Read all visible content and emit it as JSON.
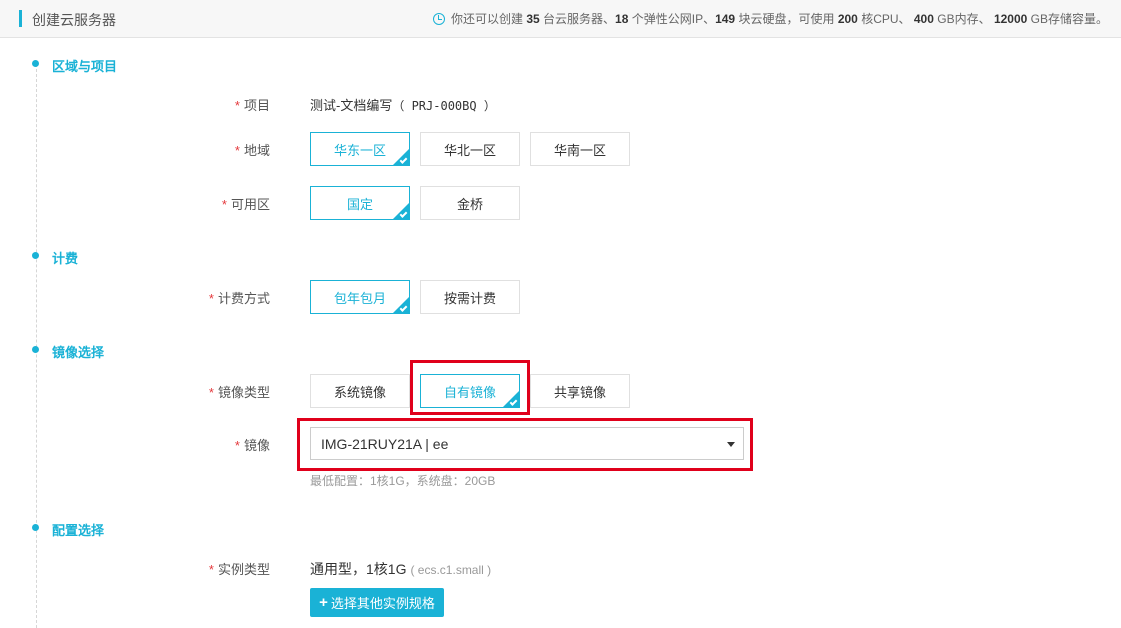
{
  "header": {
    "title": "创建云服务器",
    "quota": {
      "prefix": "你还可以创建",
      "servers": "35",
      "servers_unit": "台云服务器、",
      "ips": "18",
      "ips_unit": "个弹性公网IP、",
      "disks": "149",
      "disks_unit": "块云硬盘，可使用",
      "cpu": "200",
      "cpu_unit": "核CPU、",
      "mem": "400",
      "mem_unit": "GB内存、",
      "storage": "12000",
      "storage_unit": "GB存储容量。"
    }
  },
  "sections": {
    "region": {
      "title": "区域与项目",
      "project_label": "项目",
      "project_name": "测试-文档编写",
      "project_code": "（ PRJ-000BQ ）",
      "region_label": "地域",
      "regions": [
        "华东一区",
        "华北一区",
        "华南一区"
      ],
      "zone_label": "可用区",
      "zones": [
        "国定",
        "金桥"
      ]
    },
    "billing": {
      "title": "计费",
      "method_label": "计费方式",
      "methods": [
        "包年包月",
        "按需计费"
      ]
    },
    "image": {
      "title": "镜像选择",
      "type_label": "镜像类型",
      "types": [
        "系统镜像",
        "自有镜像",
        "共享镜像"
      ],
      "image_label": "镜像",
      "selected_image": "IMG-21RUY21A | ee",
      "hint": "最低配置：1核1G，系统盘：20GB"
    },
    "config": {
      "title": "配置选择",
      "instance_label": "实例类型",
      "instance_value": "通用型，1核1G",
      "instance_code": "( ecs.c1.small )",
      "choose_button": "选择其他实例规格"
    }
  },
  "selected": {
    "region": "华东一区",
    "zone": "国定",
    "billing": "包年包月",
    "image_type": "自有镜像"
  },
  "colors": {
    "accent": "#1ab2d6",
    "highlight": "#e0001b",
    "required": "#e4393c"
  }
}
